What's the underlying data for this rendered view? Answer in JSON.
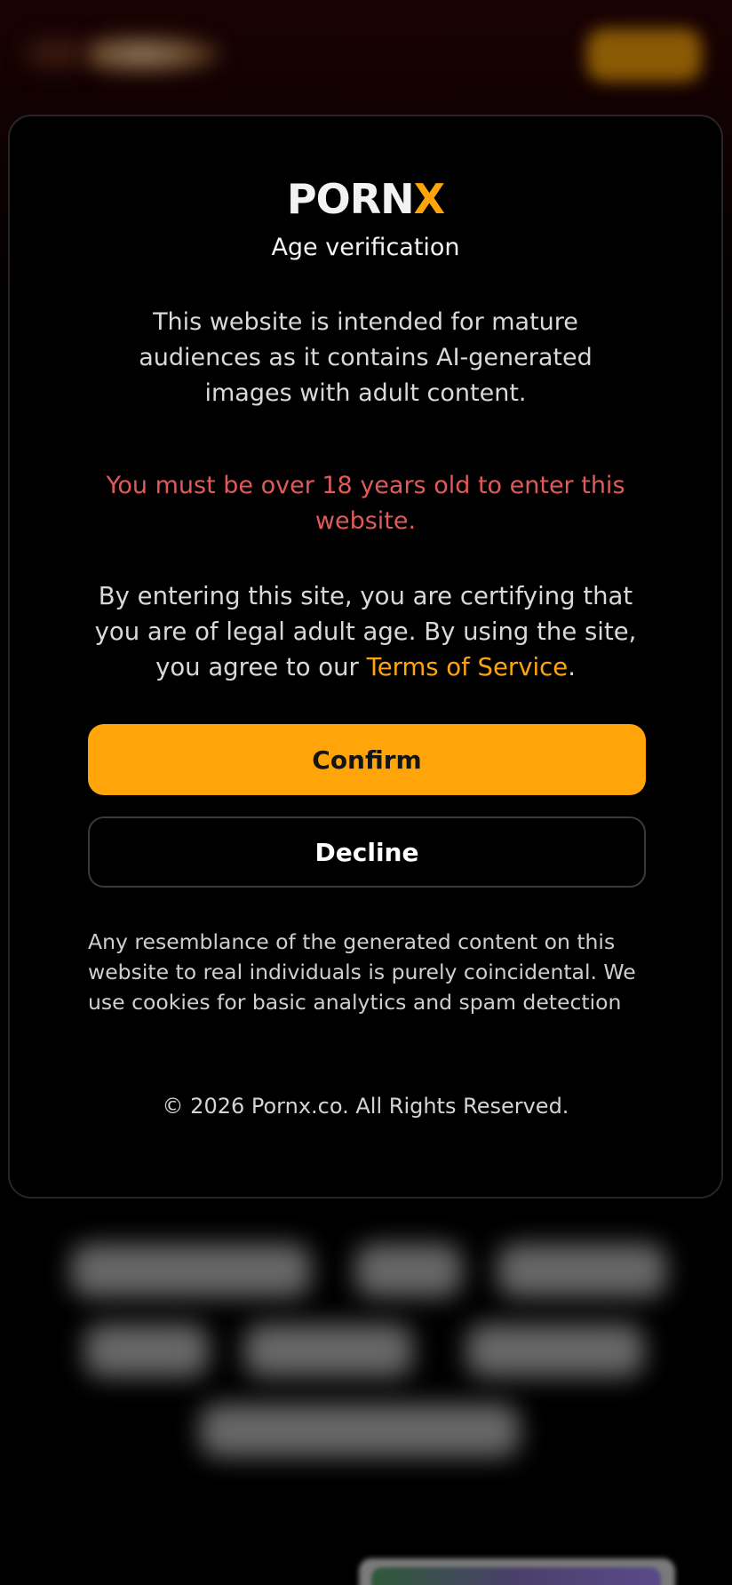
{
  "brand": {
    "name_part1": "PORN",
    "name_part2": "X"
  },
  "modal": {
    "title": "Age verification",
    "intro": "This website is intended for mature audiences as it contains AI-generated images with adult content.",
    "warning": "You must be over 18 years old to enter this website.",
    "certify_prefix": "By entering this site, you are certifying that you are of legal adult age. By using the site, you agree to our ",
    "terms_link": "Terms of Service",
    "certify_suffix": ".",
    "confirm_label": "Confirm",
    "decline_label": "Decline",
    "disclaimer": "Any resemblance of the generated content on this website to real individuals is purely coincidental. We use cookies for basic analytics and spam detection",
    "copyright": "© 2026 Pornx.co. All Rights Reserved."
  },
  "colors": {
    "accent": "#ffa50a",
    "warning": "#e05a5a",
    "background": "#000000"
  }
}
